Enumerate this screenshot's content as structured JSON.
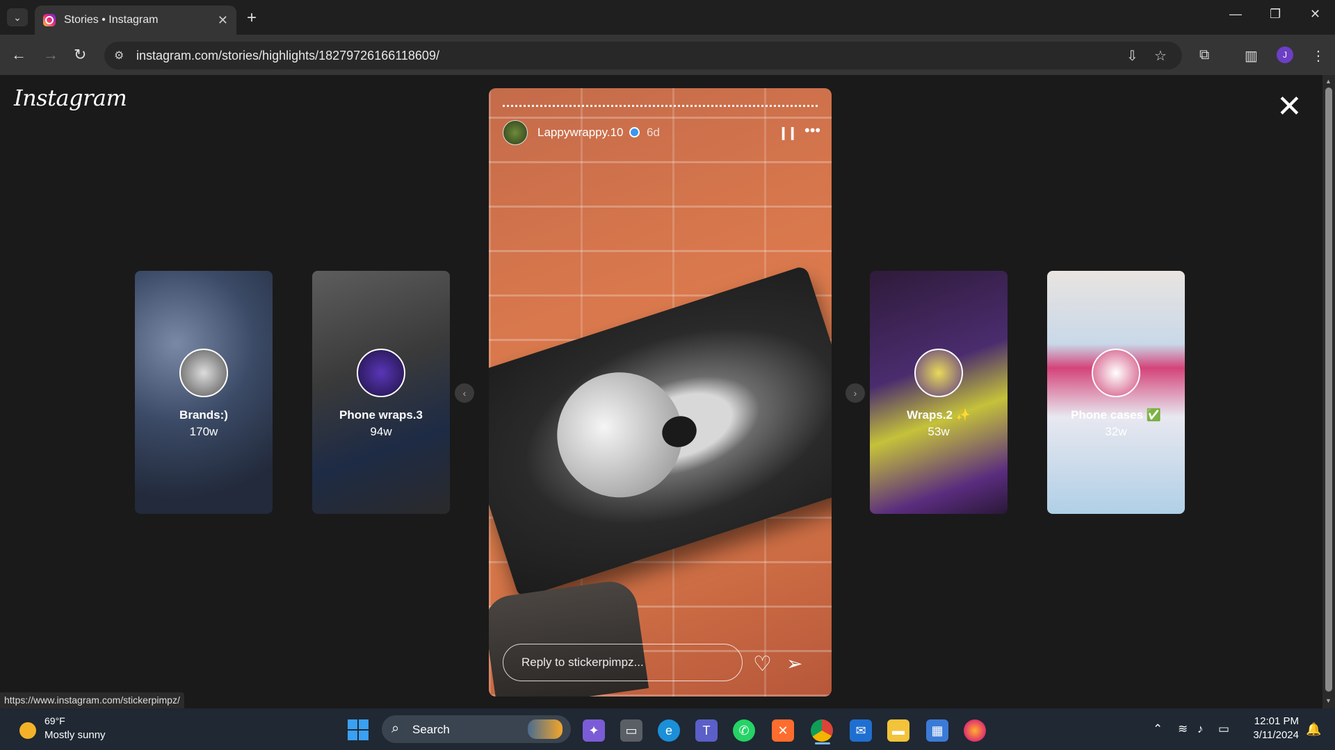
{
  "browser": {
    "tab_title": "Stories • Instagram",
    "url": "instagram.com/stories/highlights/18279726166118609/",
    "profile_initial": "J",
    "status_url": "https://www.instagram.com/stickerpimpz/"
  },
  "instagram": {
    "logo": "Instagram",
    "story": {
      "username": "Lappywrappy.10",
      "age": "6d",
      "reply_placeholder": "Reply to stickerpimpz..."
    },
    "highlights": [
      {
        "name": "Brands:)",
        "age": "170w"
      },
      {
        "name": "Phone wraps.3",
        "age": "94w"
      },
      {
        "name": "Wraps.2 ✨",
        "age": "53w"
      },
      {
        "name": "Phone cases ✅",
        "age": "32w"
      }
    ]
  },
  "taskbar": {
    "weather_temp": "69°F",
    "weather_cond": "Mostly sunny",
    "search_label": "Search",
    "time": "12:01 PM",
    "date": "3/11/2024"
  }
}
